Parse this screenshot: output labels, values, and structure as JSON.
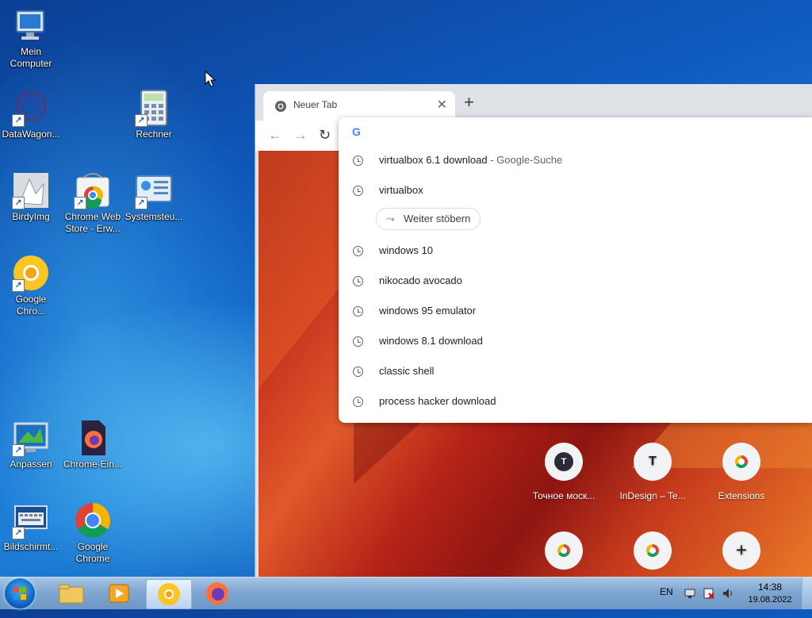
{
  "desktop": {
    "icons": [
      {
        "label": "Mein Computer",
        "glyph": "computer-icon"
      },
      {
        "label": "DataWagon...",
        "glyph": "datawagon-icon"
      },
      {
        "label": "Rechner",
        "glyph": "calculator-icon"
      },
      {
        "label": "BirdyImg",
        "glyph": "birdyimg-icon"
      },
      {
        "label": "Chrome Web Store - Erw...",
        "glyph": "chrome-web-store-icon"
      },
      {
        "label": "Systemsteu...",
        "glyph": "control-panel-icon"
      },
      {
        "label": "Google Chro...",
        "glyph": "chrome-canary-icon"
      },
      {
        "label": "Anpassen",
        "glyph": "personalize-icon"
      },
      {
        "label": "Chrome-Ein...",
        "glyph": "firefox-file-icon"
      },
      {
        "label": "Bildschirmt...",
        "glyph": "keyboard-icon"
      },
      {
        "label": "Google Chrome",
        "glyph": "chrome-icon"
      }
    ]
  },
  "browser": {
    "tab_title": "Neuer Tab",
    "tab_close": "✕",
    "new_tab": "+",
    "omnibox": {
      "suggestions": [
        {
          "text": "virtualbox 6.1 download",
          "desc": " - Google-Suche"
        },
        {
          "text": "virtualbox",
          "desc": ""
        },
        {
          "text": "windows 10",
          "desc": ""
        },
        {
          "text": "nikocado avocado",
          "desc": ""
        },
        {
          "text": "windows 95 emulator",
          "desc": ""
        },
        {
          "text": "windows 8.1 download",
          "desc": ""
        },
        {
          "text": "classic shell",
          "desc": ""
        },
        {
          "text": "process hacker download",
          "desc": ""
        }
      ],
      "chip_label": "Weiter stöbern"
    },
    "shortcuts": [
      {
        "label": "Точное моск...",
        "letter": "T"
      },
      {
        "label": "InDesign – Te...",
        "letter": "T"
      },
      {
        "label": "Extensions",
        "letter": ""
      },
      {
        "label": "",
        "letter": ""
      },
      {
        "label": "",
        "letter": ""
      },
      {
        "label": "",
        "letter": "+"
      }
    ]
  },
  "taskbar": {
    "language": "EN",
    "time": "14:38",
    "date": "19.08.2022"
  },
  "colors": {
    "accent": "#1a73e8",
    "ntp_red": "#c8331e"
  }
}
